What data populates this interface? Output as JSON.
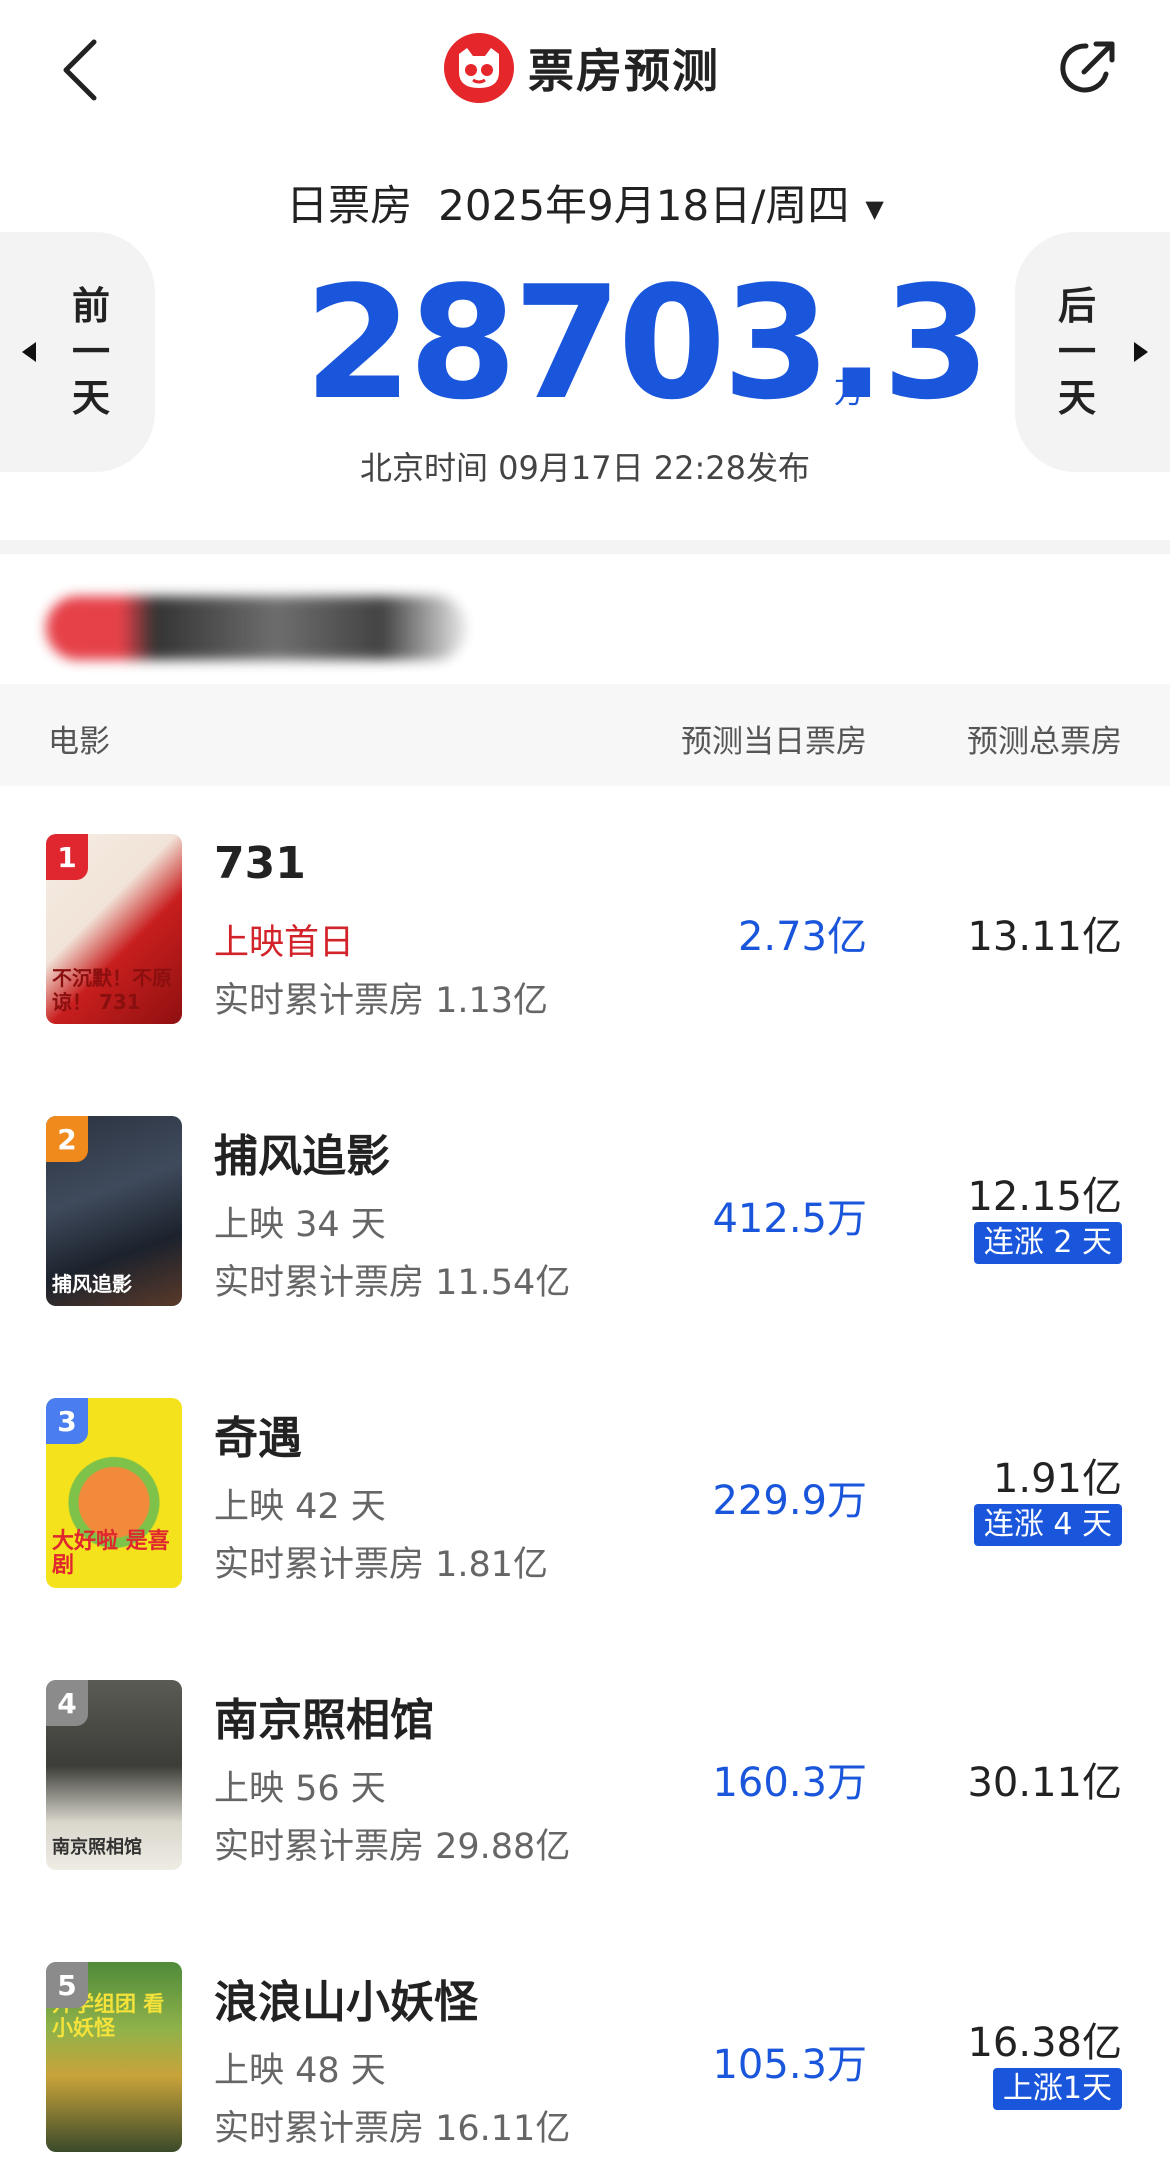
{
  "header": {
    "title": "票房预测"
  },
  "date": {
    "label": "日票房",
    "value": "2025年9月18日/周四",
    "caret": "▼"
  },
  "nav": {
    "prev": [
      "前",
      "一",
      "天"
    ],
    "next": [
      "后",
      "一",
      "天"
    ]
  },
  "total": {
    "value": "28703.3",
    "unit": "万"
  },
  "publish": "北京时间  09月17日  22:28发布",
  "table": {
    "col_movie": "电影",
    "col_day": "预测当日票房",
    "col_total": "预测总票房"
  },
  "movies": [
    {
      "rank": "1",
      "name": "731",
      "status": "上映首日",
      "cumulative": "实时累计票房 1.13亿",
      "pred_day": "2.73亿",
      "pred_total": "13.11亿",
      "badge": "",
      "rank_color": "#e0262f",
      "poster_text": "不沉默！不原谅！ 731"
    },
    {
      "rank": "2",
      "name": "捕风追影",
      "status": "上映 34 天",
      "cumulative": "实时累计票房 11.54亿",
      "pred_day": "412.5万",
      "pred_total": "12.15亿",
      "badge": "连涨 2 天",
      "rank_color": "#f08a1c",
      "poster_text": "捕风追影"
    },
    {
      "rank": "3",
      "name": "奇遇",
      "status": "上映 42 天",
      "cumulative": "实时累计票房 1.81亿",
      "pred_day": "229.9万",
      "pred_total": "1.91亿",
      "badge": "连涨 4 天",
      "rank_color": "#4a7ef0",
      "poster_text": "大好啦 是喜剧"
    },
    {
      "rank": "4",
      "name": "南京照相馆",
      "status": "上映 56 天",
      "cumulative": "实时累计票房 29.88亿",
      "pred_day": "160.3万",
      "pred_total": "30.11亿",
      "badge": "",
      "rank_color": "#8b8b8b",
      "poster_text": "南京照相馆"
    },
    {
      "rank": "5",
      "name": "浪浪山小妖怪",
      "status": "上映 48 天",
      "cumulative": "实时累计票房 16.11亿",
      "pred_day": "105.3万",
      "pred_total": "16.38亿",
      "badge": "上涨1天",
      "rank_color": "#8b8b8b",
      "poster_text": "开学组团 看小妖怪"
    }
  ]
}
